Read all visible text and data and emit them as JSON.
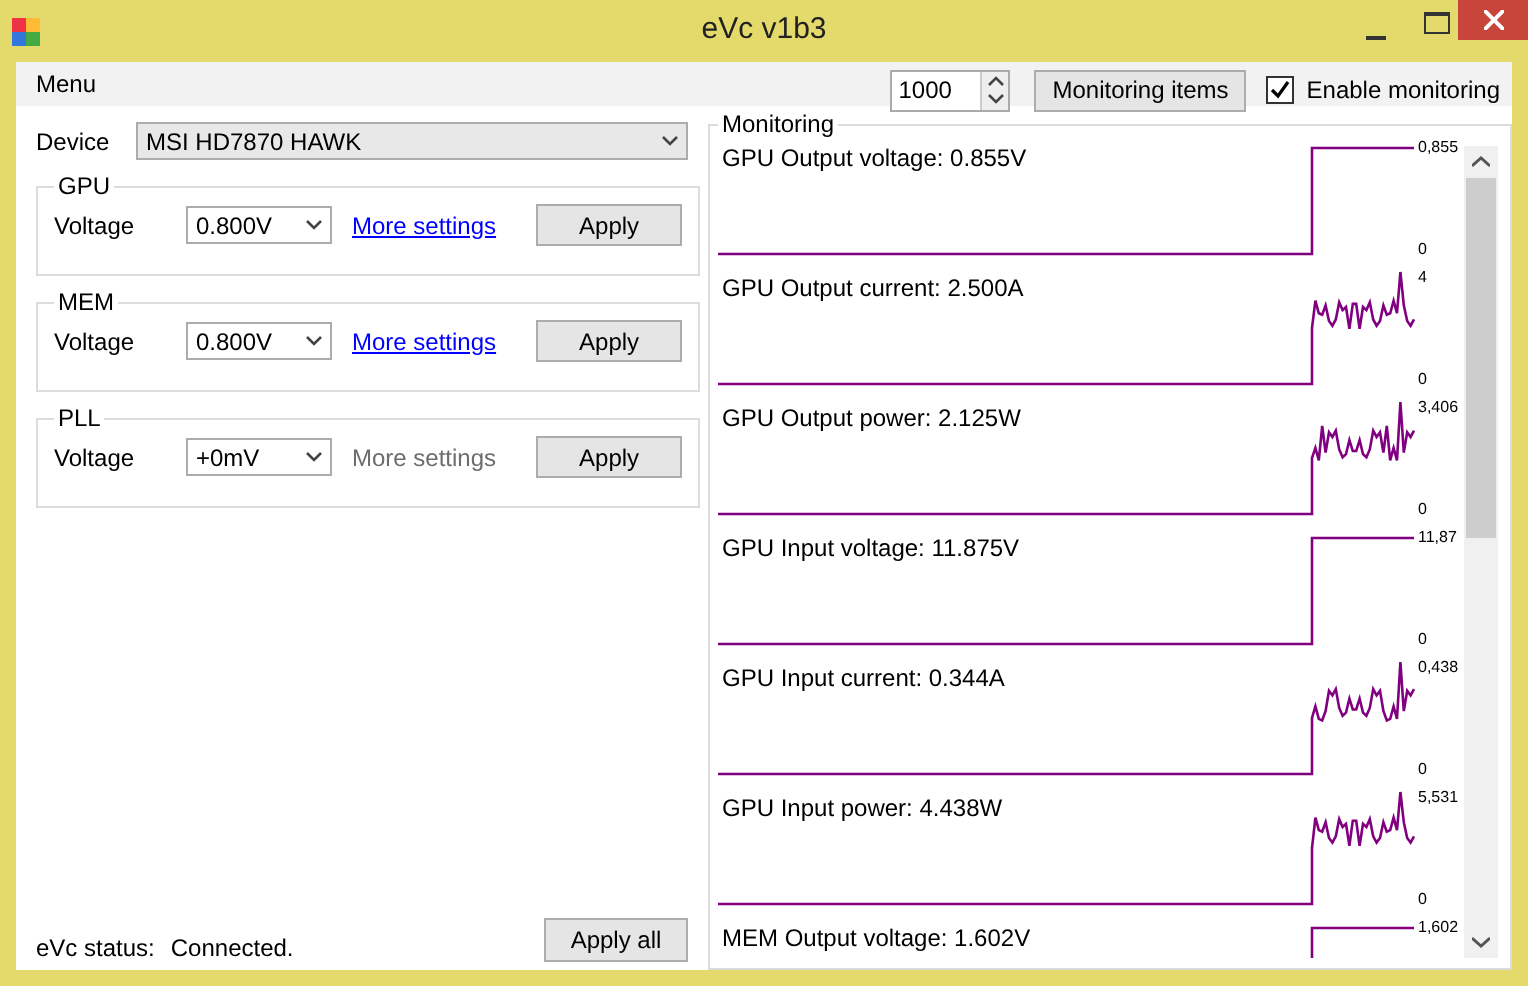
{
  "window": {
    "title": "eVc v1b3"
  },
  "menu": [
    "Menu"
  ],
  "toolbar": {
    "interval": "1000",
    "monitoring_items_button": "Monitoring items",
    "enable_monitoring": {
      "label": "Enable monitoring",
      "checked": true
    }
  },
  "device": {
    "label": "Device",
    "value": "MSI HD7870 HAWK"
  },
  "groups": [
    {
      "title": "GPU",
      "label": "Voltage",
      "value": "0.800V",
      "link": "More settings",
      "link_enabled": true,
      "button": "Apply"
    },
    {
      "title": "MEM",
      "label": "Voltage",
      "value": "0.800V",
      "link": "More settings",
      "link_enabled": true,
      "button": "Apply"
    },
    {
      "title": "PLL",
      "label": "Voltage",
      "value": "+0mV",
      "link": "More settings",
      "link_enabled": false,
      "button": "Apply"
    }
  ],
  "status": {
    "label": "eVc status:",
    "value": "Connected."
  },
  "apply_all": "Apply all",
  "monitoring": {
    "title": "Monitoring",
    "items": [
      {
        "label": "GPU Output voltage: 0.855V",
        "max": "0,855",
        "min": "0",
        "kind": "flat"
      },
      {
        "label": "GPU Output current: 2.500A",
        "max": "4",
        "min": "0",
        "kind": "noisy"
      },
      {
        "label": "GPU Output power: 2.125W",
        "max": "3,406",
        "min": "0",
        "kind": "noisy"
      },
      {
        "label": "GPU Input voltage: 11.875V",
        "max": "11,87",
        "min": "0",
        "kind": "flat"
      },
      {
        "label": "GPU Input current: 0.344A",
        "max": "0,438",
        "min": "0",
        "kind": "noisy"
      },
      {
        "label": "GPU Input power: 4.438W",
        "max": "5,531",
        "min": "0",
        "kind": "noisy"
      },
      {
        "label": "MEM Output voltage: 1.602V",
        "max": "1,602",
        "kind": "flat"
      }
    ]
  }
}
